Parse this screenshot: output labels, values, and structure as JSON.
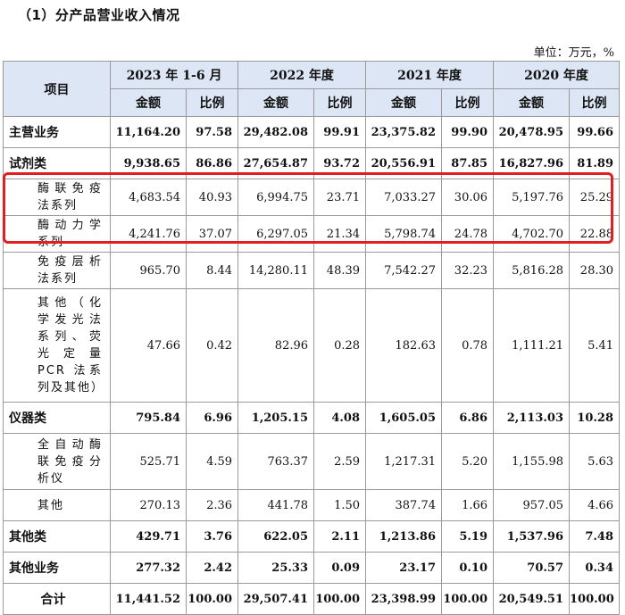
{
  "title": "（1）分产品营业收入情况",
  "unit": "单位：万元，%",
  "header": {
    "item": "项目",
    "periods": [
      "2023 年 1-6 月",
      "2022 年度",
      "2021 年度",
      "2020 年度"
    ],
    "amount": "金额",
    "ratio": "比例"
  },
  "rows": [
    {
      "name": "主营业务",
      "v": [
        "11,164.20",
        "97.58",
        "29,482.08",
        "99.91",
        "23,375.82",
        "99.90",
        "20,478.95",
        "99.66"
      ]
    },
    {
      "name": "试剂类",
      "v": [
        "9,938.65",
        "86.86",
        "27,654.87",
        "93.72",
        "20,556.91",
        "87.85",
        "16,827.96",
        "81.89"
      ]
    },
    {
      "name": "酶联免疫法系列",
      "v": [
        "4,683.54",
        "40.93",
        "6,994.75",
        "23.71",
        "7,033.27",
        "30.06",
        "5,197.76",
        "25.29"
      ]
    },
    {
      "name": "酶动力学系列",
      "v": [
        "4,241.76",
        "37.07",
        "6,297.05",
        "21.34",
        "5,798.74",
        "24.78",
        "4,702.70",
        "22.88"
      ]
    },
    {
      "name": "免疫层析法系列",
      "v": [
        "965.70",
        "8.44",
        "14,280.11",
        "48.39",
        "7,542.27",
        "32.23",
        "5,816.28",
        "28.30"
      ]
    },
    {
      "name": "其他（化学发光法系列、荧光定量 PCR 法系列及其他）",
      "v": [
        "47.66",
        "0.42",
        "82.96",
        "0.28",
        "182.63",
        "0.78",
        "1,111.21",
        "5.41"
      ]
    },
    {
      "name": "仪器类",
      "v": [
        "795.84",
        "6.96",
        "1,205.15",
        "4.08",
        "1,605.05",
        "6.86",
        "2,113.03",
        "10.28"
      ]
    },
    {
      "name": "全自动酶联免疫分析仪",
      "v": [
        "525.71",
        "4.59",
        "763.37",
        "2.59",
        "1,217.31",
        "5.20",
        "1,155.98",
        "5.63"
      ]
    },
    {
      "name": "其他",
      "v": [
        "270.13",
        "2.36",
        "441.78",
        "1.50",
        "387.74",
        "1.66",
        "957.05",
        "4.66"
      ]
    },
    {
      "name": "其他类",
      "v": [
        "429.71",
        "3.76",
        "622.05",
        "2.11",
        "1,213.86",
        "5.19",
        "1,537.96",
        "7.48"
      ]
    },
    {
      "name": "其他业务",
      "v": [
        "277.32",
        "2.42",
        "25.33",
        "0.09",
        "23.17",
        "0.10",
        "70.57",
        "0.34"
      ]
    },
    {
      "name": "合计",
      "v": [
        "11,441.52",
        "100.00",
        "29,507.41",
        "100.00",
        "23,398.99",
        "100.00",
        "20,549.51",
        "100.00"
      ]
    }
  ],
  "highlight_color": "#e02020",
  "header_color": "#dde6f4"
}
